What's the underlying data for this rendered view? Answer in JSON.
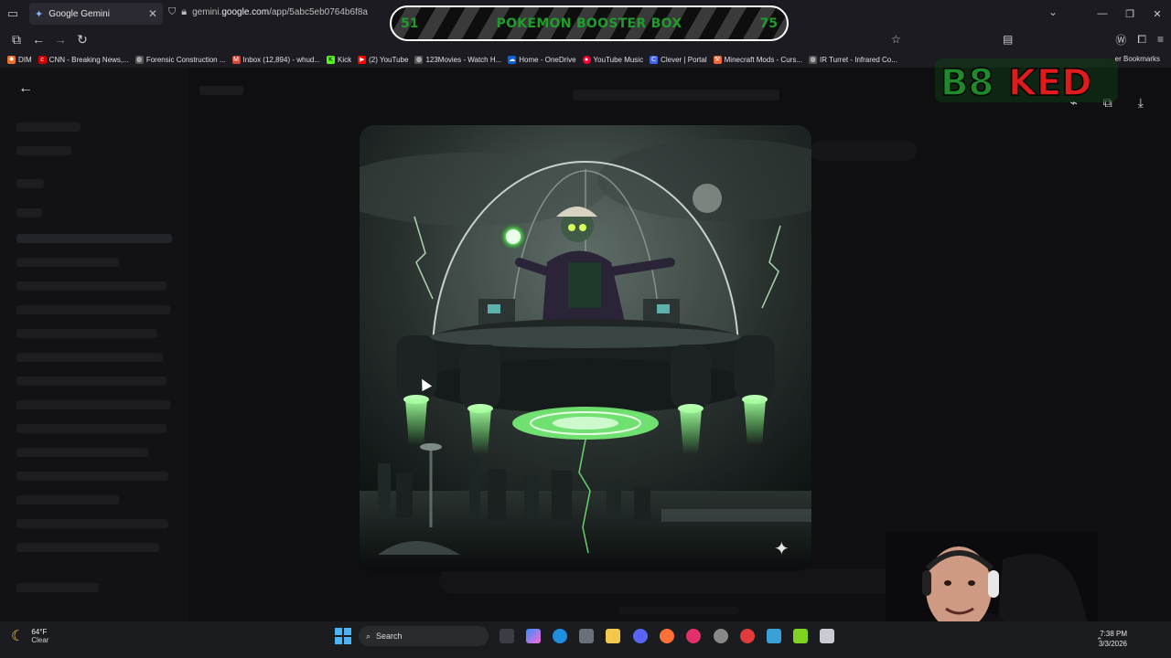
{
  "browser": {
    "tab_title": "Google Gemini",
    "url_prefix": "gemini.",
    "url_domain": "google.com",
    "url_path": "/app/5abc5eb0764b6f8a"
  },
  "bookmarks": [
    {
      "label": "DIM",
      "color": "#e8702a"
    },
    {
      "label": "CNN - Breaking News,...",
      "color": "#cc0000"
    },
    {
      "label": "Forensic Construction ...",
      "color": "#888888"
    },
    {
      "label": "Inbox (12,894) - whud...",
      "color": "#d44638"
    },
    {
      "label": "Kick",
      "color": "#53fc18"
    },
    {
      "label": "(2) YouTube",
      "color": "#ff0000"
    },
    {
      "label": "123Movies - Watch H...",
      "color": "#888888"
    },
    {
      "label": "Home - OneDrive",
      "color": "#0a64d8"
    },
    {
      "label": "YouTube Music",
      "color": "#ff0033"
    },
    {
      "label": "Clever | Portal",
      "color": "#4263eb"
    },
    {
      "label": "Minecraft Mods - Curs...",
      "color": "#f16436"
    },
    {
      "label": "IR Turret - Infrared Co...",
      "color": "#888888"
    }
  ],
  "bookmarks_other": "er Bookmarks",
  "overlay": {
    "left_count": "51",
    "title": "POKEMON BOOSTER BOX",
    "right_count": "75",
    "logo_text": "B8KED"
  },
  "taskbar": {
    "weather_temp": "64°F",
    "weather_cond": "Clear",
    "search_label": "Search",
    "time": "7:38 PM",
    "date": "3/3/2026"
  },
  "colors": {
    "counter_green": "#1f9c2c",
    "glow_green": "#66ff66",
    "logo_red": "#e11b1b",
    "logo_green": "#1f8a2a"
  }
}
